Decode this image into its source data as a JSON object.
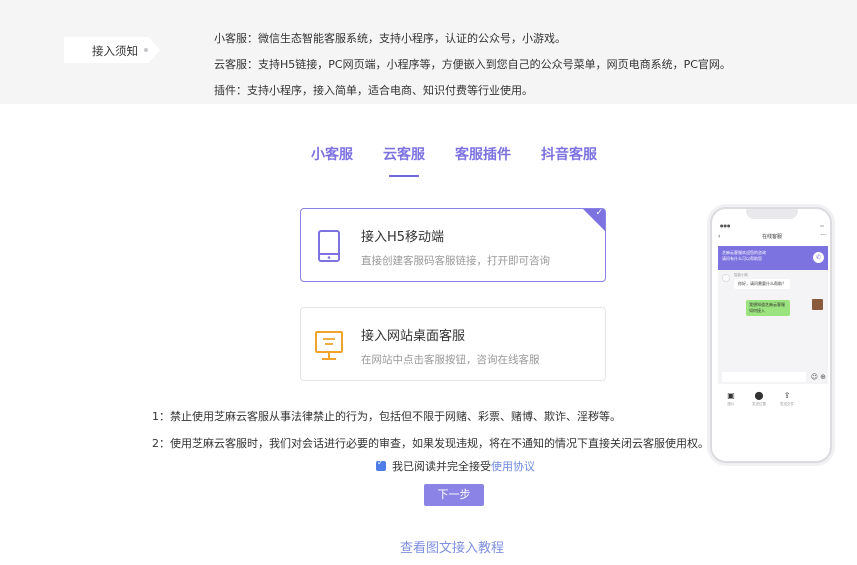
{
  "notice": {
    "tag": "接入须知",
    "lines": [
      "小客服：微信生态智能客服系统，支持小程序，认证的公众号，小游戏。",
      "云客服：支持H5链接，PC网页端，小程序等，方便嵌入到您自己的公众号菜单，网页电商系统，PC官网。",
      "插件：支持小程序，接入简单，适合电商、知识付费等行业使用。"
    ]
  },
  "tabs": [
    {
      "label": "小客服"
    },
    {
      "label": "云客服",
      "active": true
    },
    {
      "label": "客服插件"
    },
    {
      "label": "抖音客服"
    }
  ],
  "options": [
    {
      "title": "接入H5移动端",
      "desc": "直接创建客服码客服链接，打开即可咨询",
      "icon": "mobile-phone-icon",
      "selected": true
    },
    {
      "title": "接入网站桌面客服",
      "desc": "在网站中点击客服按钮，咨询在线客服",
      "icon": "desktop-monitor-icon",
      "selected": false
    }
  ],
  "rules": [
    "1：禁止使用芝麻云客服从事法律禁止的行为，包括但不限于网赌、彩票、赌博、欺诈、淫秽等。",
    "2：使用芝麻云客服时，我们对会话进行必要的审查，如果发现违规，将在不通知的情况下直接关闭云客服使用权。"
  ],
  "agreement": {
    "checked": true,
    "text": "我已阅读并完全接受",
    "link": "使用协议"
  },
  "next_button": "下一步",
  "tutorial_link": "查看图文接入教程",
  "colors": {
    "accent": "#7c72e0",
    "banner_bg": "#f5f5f6",
    "checkbox": "#4f7de8",
    "user_bubble": "#9be37e"
  },
  "phone": {
    "nav_title": "在线客服",
    "header_line1": "芝麻云客服欢迎您的咨询",
    "header_line2": "请问有什么可以帮助您",
    "agent_name": "智能小助",
    "agent_message": "你好，请问需要什么帮助？",
    "user_message": "我想知道芝麻云客服如何接入",
    "tools": [
      "图片",
      "发送位置",
      "发送文件"
    ]
  }
}
